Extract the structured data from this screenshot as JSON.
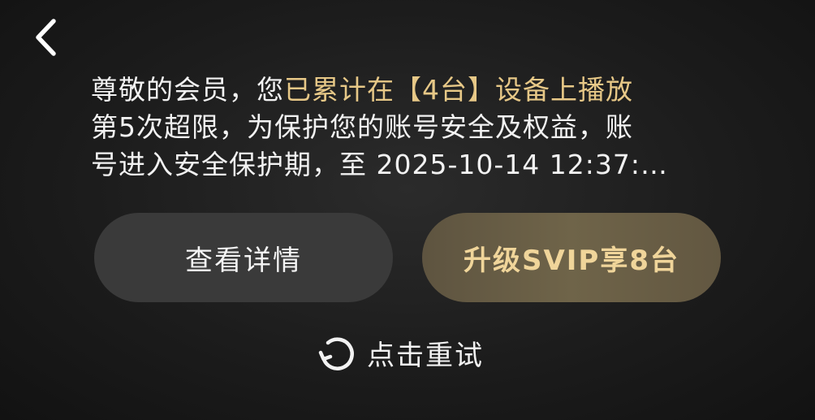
{
  "nav": {
    "back_icon": "chevron-left-icon"
  },
  "message": {
    "line1_prefix": "尊敬的会员，您",
    "line1_highlight": "已累计在【4台】设备上播放",
    "line2": "第5次超限，为保护您的账号安全及权益，账",
    "line3": "号进入安全保护期，至 2025-10-14 12:37:…"
  },
  "buttons": {
    "detail_label": "查看详情",
    "upgrade_label": "升级SVIP享8台"
  },
  "retry": {
    "icon": "refresh-icon",
    "label": "点击重试"
  },
  "colors": {
    "highlight": "#e7c887",
    "upgrade_text": "#f0d59a",
    "detail_bg": "#3a3a3a",
    "upgrade_bg": "#6f6449"
  }
}
